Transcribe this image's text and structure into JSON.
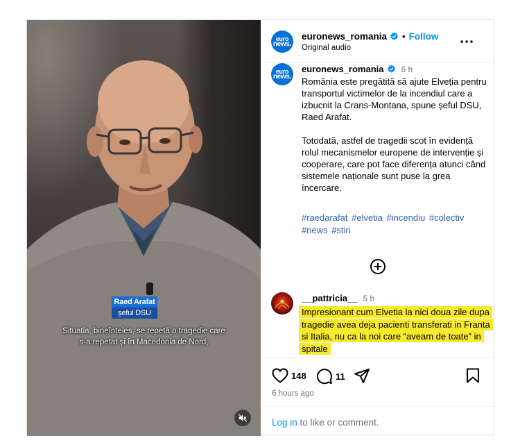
{
  "account": {
    "username": "euronews_romania",
    "follow_label": "Follow",
    "audio_label": "Original audio",
    "avatar_line1": "euro",
    "avatar_line2": "news."
  },
  "video": {
    "lower_third_name": "Raed Arafat",
    "lower_third_role": "șeful DSU",
    "subtitle_line1": "Situația, bineînțeles, se repetă o tragedie care",
    "subtitle_line2": "s-a repetat și în Macedonia de Nord,",
    "mute_icon": "speaker-muted-icon"
  },
  "caption": {
    "username": "euronews_romania",
    "time": "6 h",
    "paragraph1": "România este pregătită să ajute Elveția pentru transportul victimelor de la incendiul care a izbucnit la Crans-Montana, spune șeful DSU, Raed Arafat.",
    "paragraph2": "Totodată, astfel de tragedii scot în evidență rolul mecanismelor europene de intervenție și cooperare, care pot face diferența atunci când sistemele naționale sunt puse la grea încercare.",
    "hashtags": [
      "#raedarafat",
      "#elvetia",
      "#incendiu",
      "#colectiv",
      "#news",
      "#stiri"
    ]
  },
  "comment": {
    "username": "__pattricia__",
    "time": "5 h",
    "text": "Impresionant cum Elvetia la nici doua zile dupa tragedie avea deja pacienti transferati in Franta si Italia, nu ca la noi care “aveam de toate” in spitale",
    "highlight_color": "#f7ea2c"
  },
  "actions": {
    "likes": "148",
    "comments": "11",
    "posted": "6 hours ago"
  },
  "login": {
    "link": "Log in",
    "rest": " to like or comment."
  },
  "colors": {
    "accent": "#0095f6",
    "brand": "#0a6fd7",
    "hashtag": "#2b5bb3"
  }
}
